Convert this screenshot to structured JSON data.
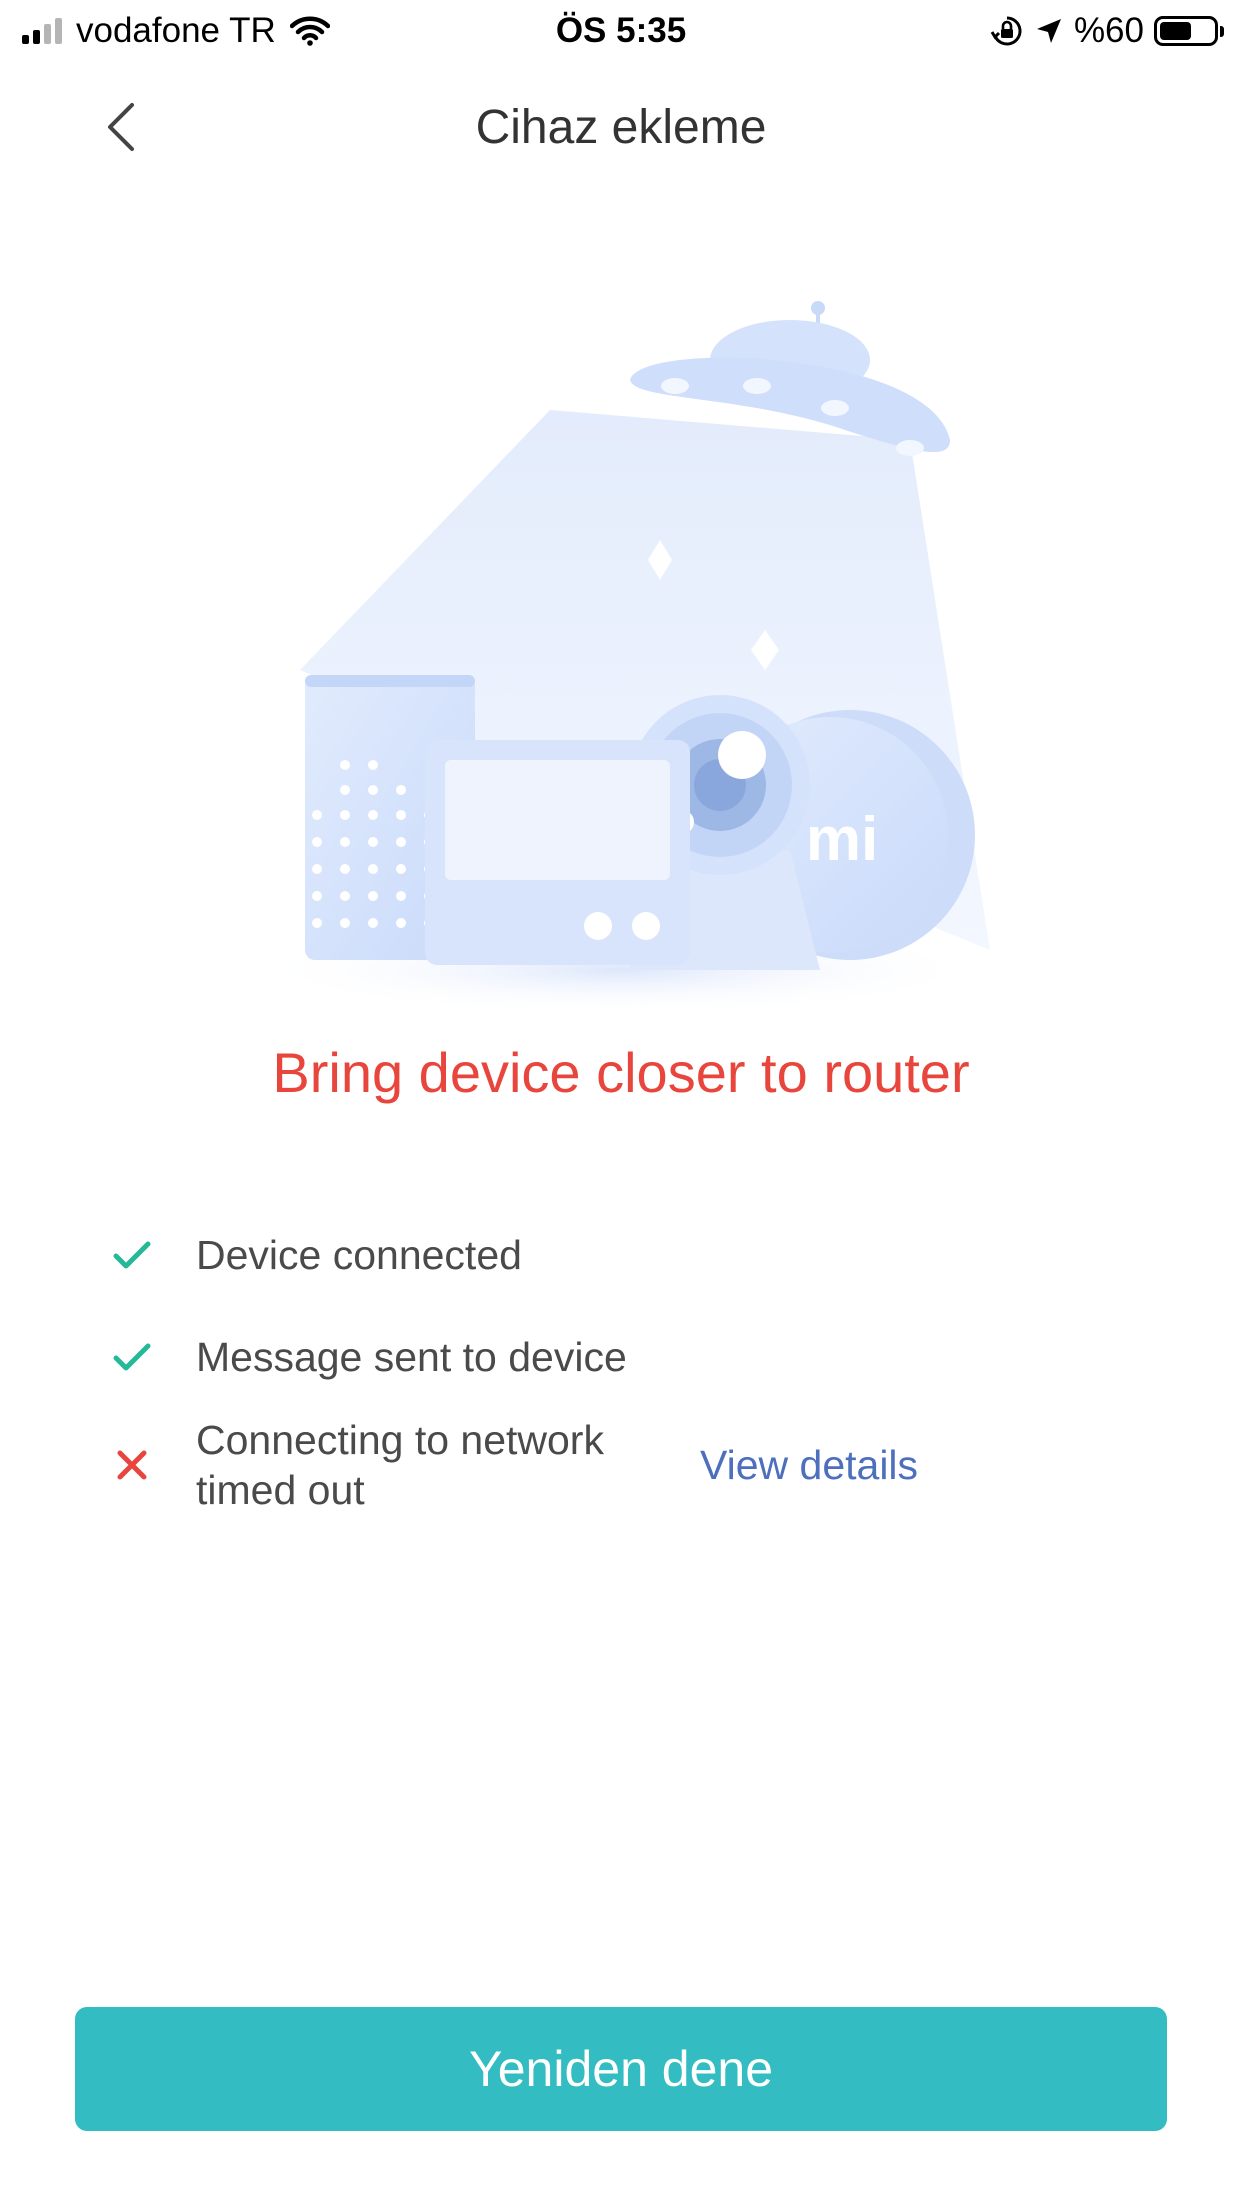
{
  "status_bar": {
    "carrier": "vodafone TR",
    "time": "ÖS 5:35",
    "battery": "%60",
    "battery_level": 0.6
  },
  "nav": {
    "title": "Cihaz ekleme"
  },
  "result": {
    "title": "Bring device closer to router"
  },
  "steps": [
    {
      "status": "done",
      "label": "Device connected"
    },
    {
      "status": "done",
      "label": "Message sent to device"
    },
    {
      "status": "failed",
      "label": "Connecting to network timed out",
      "link": "View details"
    }
  ],
  "colors": {
    "success": "#25b99a",
    "error": "#e8453c",
    "link": "#4d6fbd",
    "button": "#33bcc1"
  },
  "illustration": {
    "logo_text": "mi"
  },
  "retry_button": {
    "label": "Yeniden dene"
  }
}
